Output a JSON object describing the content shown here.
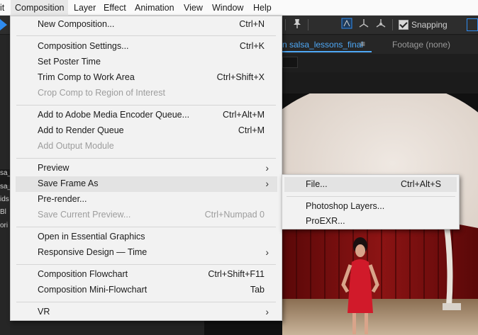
{
  "menubar": {
    "items": [
      {
        "label": "it"
      },
      {
        "label": "Composition"
      },
      {
        "label": "Layer"
      },
      {
        "label": "Effect"
      },
      {
        "label": "Animation"
      },
      {
        "label": "View"
      },
      {
        "label": "Window"
      },
      {
        "label": "Help"
      }
    ]
  },
  "toolbar": {
    "snapping_label": "Snapping",
    "snapping_checked": true
  },
  "panel": {
    "active_tab": "n salsa_lessons_final",
    "tab_menu_glyph": "≡",
    "footage_tab": "Footage (none)"
  },
  "left_panel_rows": [
    "sa_",
    "sa_",
    "ids",
    "Bl",
    "ori"
  ],
  "composition_menu": {
    "items": [
      {
        "label": "New Composition...",
        "shortcut": "Ctrl+N"
      },
      {
        "label": "Composition Settings...",
        "shortcut": "Ctrl+K"
      },
      {
        "label": "Set Poster Time",
        "shortcut": ""
      },
      {
        "label": "Trim Comp to Work Area",
        "shortcut": "Ctrl+Shift+X"
      },
      {
        "label": "Crop Comp to Region of Interest",
        "shortcut": "",
        "disabled": true
      },
      {
        "label": "Add to Adobe Media Encoder Queue...",
        "shortcut": "Ctrl+Alt+M"
      },
      {
        "label": "Add to Render Queue",
        "shortcut": "Ctrl+M"
      },
      {
        "label": "Add Output Module",
        "shortcut": "",
        "disabled": true
      },
      {
        "label": "Preview",
        "submenu": true
      },
      {
        "label": "Save Frame As",
        "submenu": true,
        "highlighted": true
      },
      {
        "label": "Pre-render...",
        "shortcut": ""
      },
      {
        "label": "Save Current Preview...",
        "shortcut": "Ctrl+Numpad 0",
        "disabled": true
      },
      {
        "label": "Open in Essential Graphics",
        "shortcut": ""
      },
      {
        "label": "Responsive Design — Time",
        "submenu": true
      },
      {
        "label": "Composition Flowchart",
        "shortcut": "Ctrl+Shift+F11"
      },
      {
        "label": "Composition Mini-Flowchart",
        "shortcut": "Tab"
      },
      {
        "label": "VR",
        "submenu": true
      }
    ]
  },
  "save_frame_submenu": {
    "items": [
      {
        "label": "File...",
        "shortcut": "Ctrl+Alt+S",
        "highlighted": true
      },
      {
        "label": "Photoshop Layers..."
      },
      {
        "label": "ProEXR..."
      }
    ]
  },
  "colors": {
    "accent": "#2f8cf0",
    "menu_bg": "#f2f2f2",
    "menu_hover": "#e3e3e3",
    "app_bg": "#232323"
  }
}
